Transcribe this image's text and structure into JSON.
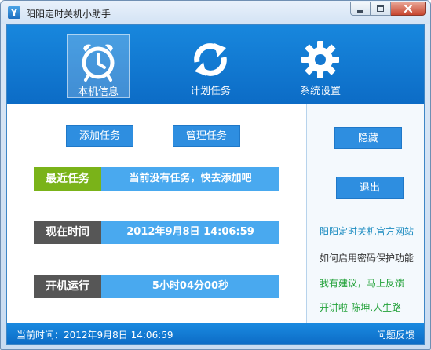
{
  "window": {
    "title": "阳阳定时关机小助手",
    "app_icon_letter": "Y"
  },
  "toolbar": {
    "items": [
      {
        "label": "本机信息",
        "icon": "alarm-clock-icon",
        "active": true
      },
      {
        "label": "计划任务",
        "icon": "refresh-arrows-icon",
        "active": false
      },
      {
        "label": "系统设置",
        "icon": "gear-icon",
        "active": false
      }
    ]
  },
  "main": {
    "add_task": "添加任务",
    "manage_task": "管理任务",
    "rows": [
      {
        "label": "最近任务",
        "value": "当前没有任务，快去添加吧",
        "label_color": "#7ab319"
      },
      {
        "label": "现在时间",
        "value": "2012年9月8日  14:06:59",
        "label_color": "#565656"
      },
      {
        "label": "开机运行",
        "value": "5小时04分00秒",
        "label_color": "#565656"
      }
    ]
  },
  "side": {
    "hide": "隐藏",
    "exit": "退出",
    "links": [
      {
        "text": "阳阳定时关机官方网站",
        "color": "#1a8bc0"
      },
      {
        "text": "如何启用密码保护功能",
        "color": "#333333"
      },
      {
        "text": "我有建议，马上反馈",
        "color": "#23a23a"
      },
      {
        "text": "开讲啦-陈坤.人生路",
        "color": "#23a23a"
      }
    ]
  },
  "status": {
    "current_time": "当前时间：2012年9月8日 14:06:59",
    "feedback": "问题反馈"
  },
  "colors": {
    "accent": "#0c6cc6",
    "button": "#2e8ee0",
    "value_bg": "#49a9ef"
  }
}
